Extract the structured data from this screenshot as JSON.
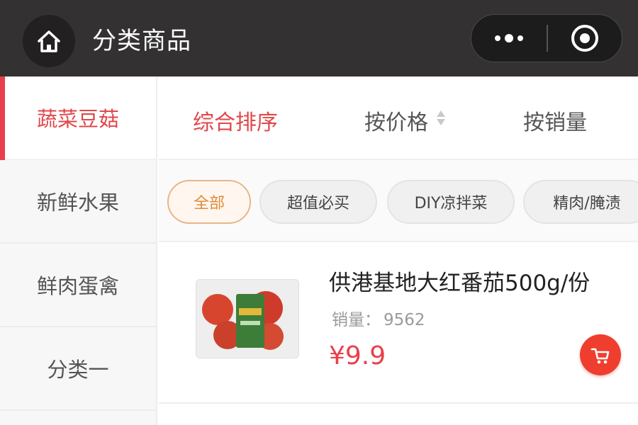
{
  "nav": {
    "title": "分类商品",
    "home_icon": "home-icon",
    "more_icon": "more-dots-icon",
    "close_icon": "target-close-icon"
  },
  "sidebar": {
    "items": [
      {
        "label": "蔬菜豆菇",
        "active": true
      },
      {
        "label": "新鲜水果",
        "active": false
      },
      {
        "label": "鲜肉蛋禽",
        "active": false
      },
      {
        "label": "分类一",
        "active": false
      }
    ]
  },
  "sort": {
    "options": [
      {
        "label": "综合排序",
        "active": true
      },
      {
        "label": "按价格",
        "active": false
      },
      {
        "label": "按销量",
        "active": false
      }
    ]
  },
  "filters": {
    "chips": [
      {
        "label": "全部",
        "active": true
      },
      {
        "label": "超值必买",
        "active": false
      },
      {
        "label": "DIY凉拌菜",
        "active": false
      },
      {
        "label": "精肉/腌渍",
        "active": false
      }
    ]
  },
  "products": [
    {
      "name": "供港基地大红番茄500g/份",
      "sales_label": "销量：",
      "sales_value": "9562",
      "price": "¥9.9",
      "cart_icon": "cart-icon"
    }
  ],
  "colors": {
    "accent": "#e8404a",
    "topbar": "#333131",
    "chip_active": "#e08a3c"
  }
}
